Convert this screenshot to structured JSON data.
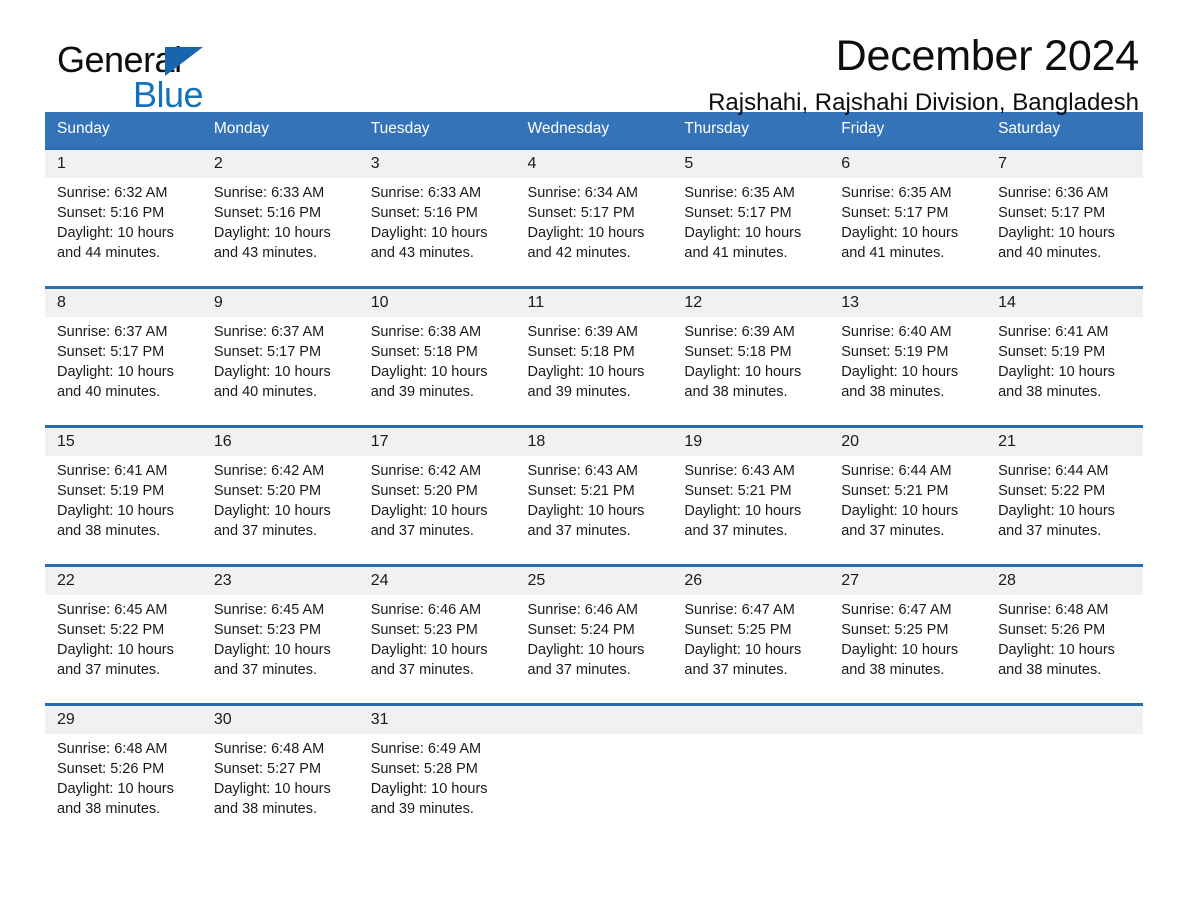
{
  "brand": {
    "name_part1": "General",
    "name_part2": "Blue",
    "triangle_color": "#1665ad",
    "blue_color": "#1272bd"
  },
  "header": {
    "title": "December 2024",
    "subtitle": "Rajshahi, Rajshahi Division, Bangladesh"
  },
  "theme": {
    "header_bar_color": "#3573b9",
    "row_top_border_color": "#2a6cb0",
    "daynum_band_color": "#f1f1f1"
  },
  "calendar": {
    "weekday_headers": [
      "Sunday",
      "Monday",
      "Tuesday",
      "Wednesday",
      "Thursday",
      "Friday",
      "Saturday"
    ],
    "weeks": [
      {
        "daynums": [
          "1",
          "2",
          "3",
          "4",
          "5",
          "6",
          "7"
        ],
        "cells": [
          {
            "sunrise": "Sunrise: 6:32 AM",
            "sunset": "Sunset: 5:16 PM",
            "daylight_1": "Daylight: 10 hours",
            "daylight_2": "and 44 minutes."
          },
          {
            "sunrise": "Sunrise: 6:33 AM",
            "sunset": "Sunset: 5:16 PM",
            "daylight_1": "Daylight: 10 hours",
            "daylight_2": "and 43 minutes."
          },
          {
            "sunrise": "Sunrise: 6:33 AM",
            "sunset": "Sunset: 5:16 PM",
            "daylight_1": "Daylight: 10 hours",
            "daylight_2": "and 43 minutes."
          },
          {
            "sunrise": "Sunrise: 6:34 AM",
            "sunset": "Sunset: 5:17 PM",
            "daylight_1": "Daylight: 10 hours",
            "daylight_2": "and 42 minutes."
          },
          {
            "sunrise": "Sunrise: 6:35 AM",
            "sunset": "Sunset: 5:17 PM",
            "daylight_1": "Daylight: 10 hours",
            "daylight_2": "and 41 minutes."
          },
          {
            "sunrise": "Sunrise: 6:35 AM",
            "sunset": "Sunset: 5:17 PM",
            "daylight_1": "Daylight: 10 hours",
            "daylight_2": "and 41 minutes."
          },
          {
            "sunrise": "Sunrise: 6:36 AM",
            "sunset": "Sunset: 5:17 PM",
            "daylight_1": "Daylight: 10 hours",
            "daylight_2": "and 40 minutes."
          }
        ]
      },
      {
        "daynums": [
          "8",
          "9",
          "10",
          "11",
          "12",
          "13",
          "14"
        ],
        "cells": [
          {
            "sunrise": "Sunrise: 6:37 AM",
            "sunset": "Sunset: 5:17 PM",
            "daylight_1": "Daylight: 10 hours",
            "daylight_2": "and 40 minutes."
          },
          {
            "sunrise": "Sunrise: 6:37 AM",
            "sunset": "Sunset: 5:17 PM",
            "daylight_1": "Daylight: 10 hours",
            "daylight_2": "and 40 minutes."
          },
          {
            "sunrise": "Sunrise: 6:38 AM",
            "sunset": "Sunset: 5:18 PM",
            "daylight_1": "Daylight: 10 hours",
            "daylight_2": "and 39 minutes."
          },
          {
            "sunrise": "Sunrise: 6:39 AM",
            "sunset": "Sunset: 5:18 PM",
            "daylight_1": "Daylight: 10 hours",
            "daylight_2": "and 39 minutes."
          },
          {
            "sunrise": "Sunrise: 6:39 AM",
            "sunset": "Sunset: 5:18 PM",
            "daylight_1": "Daylight: 10 hours",
            "daylight_2": "and 38 minutes."
          },
          {
            "sunrise": "Sunrise: 6:40 AM",
            "sunset": "Sunset: 5:19 PM",
            "daylight_1": "Daylight: 10 hours",
            "daylight_2": "and 38 minutes."
          },
          {
            "sunrise": "Sunrise: 6:41 AM",
            "sunset": "Sunset: 5:19 PM",
            "daylight_1": "Daylight: 10 hours",
            "daylight_2": "and 38 minutes."
          }
        ]
      },
      {
        "daynums": [
          "15",
          "16",
          "17",
          "18",
          "19",
          "20",
          "21"
        ],
        "cells": [
          {
            "sunrise": "Sunrise: 6:41 AM",
            "sunset": "Sunset: 5:19 PM",
            "daylight_1": "Daylight: 10 hours",
            "daylight_2": "and 38 minutes."
          },
          {
            "sunrise": "Sunrise: 6:42 AM",
            "sunset": "Sunset: 5:20 PM",
            "daylight_1": "Daylight: 10 hours",
            "daylight_2": "and 37 minutes."
          },
          {
            "sunrise": "Sunrise: 6:42 AM",
            "sunset": "Sunset: 5:20 PM",
            "daylight_1": "Daylight: 10 hours",
            "daylight_2": "and 37 minutes."
          },
          {
            "sunrise": "Sunrise: 6:43 AM",
            "sunset": "Sunset: 5:21 PM",
            "daylight_1": "Daylight: 10 hours",
            "daylight_2": "and 37 minutes."
          },
          {
            "sunrise": "Sunrise: 6:43 AM",
            "sunset": "Sunset: 5:21 PM",
            "daylight_1": "Daylight: 10 hours",
            "daylight_2": "and 37 minutes."
          },
          {
            "sunrise": "Sunrise: 6:44 AM",
            "sunset": "Sunset: 5:21 PM",
            "daylight_1": "Daylight: 10 hours",
            "daylight_2": "and 37 minutes."
          },
          {
            "sunrise": "Sunrise: 6:44 AM",
            "sunset": "Sunset: 5:22 PM",
            "daylight_1": "Daylight: 10 hours",
            "daylight_2": "and 37 minutes."
          }
        ]
      },
      {
        "daynums": [
          "22",
          "23",
          "24",
          "25",
          "26",
          "27",
          "28"
        ],
        "cells": [
          {
            "sunrise": "Sunrise: 6:45 AM",
            "sunset": "Sunset: 5:22 PM",
            "daylight_1": "Daylight: 10 hours",
            "daylight_2": "and 37 minutes."
          },
          {
            "sunrise": "Sunrise: 6:45 AM",
            "sunset": "Sunset: 5:23 PM",
            "daylight_1": "Daylight: 10 hours",
            "daylight_2": "and 37 minutes."
          },
          {
            "sunrise": "Sunrise: 6:46 AM",
            "sunset": "Sunset: 5:23 PM",
            "daylight_1": "Daylight: 10 hours",
            "daylight_2": "and 37 minutes."
          },
          {
            "sunrise": "Sunrise: 6:46 AM",
            "sunset": "Sunset: 5:24 PM",
            "daylight_1": "Daylight: 10 hours",
            "daylight_2": "and 37 minutes."
          },
          {
            "sunrise": "Sunrise: 6:47 AM",
            "sunset": "Sunset: 5:25 PM",
            "daylight_1": "Daylight: 10 hours",
            "daylight_2": "and 37 minutes."
          },
          {
            "sunrise": "Sunrise: 6:47 AM",
            "sunset": "Sunset: 5:25 PM",
            "daylight_1": "Daylight: 10 hours",
            "daylight_2": "and 38 minutes."
          },
          {
            "sunrise": "Sunrise: 6:48 AM",
            "sunset": "Sunset: 5:26 PM",
            "daylight_1": "Daylight: 10 hours",
            "daylight_2": "and 38 minutes."
          }
        ]
      },
      {
        "daynums": [
          "29",
          "30",
          "31",
          "",
          "",
          "",
          ""
        ],
        "cells": [
          {
            "sunrise": "Sunrise: 6:48 AM",
            "sunset": "Sunset: 5:26 PM",
            "daylight_1": "Daylight: 10 hours",
            "daylight_2": "and 38 minutes."
          },
          {
            "sunrise": "Sunrise: 6:48 AM",
            "sunset": "Sunset: 5:27 PM",
            "daylight_1": "Daylight: 10 hours",
            "daylight_2": "and 38 minutes."
          },
          {
            "sunrise": "Sunrise: 6:49 AM",
            "sunset": "Sunset: 5:28 PM",
            "daylight_1": "Daylight: 10 hours",
            "daylight_2": "and 39 minutes."
          },
          {
            "sunrise": "",
            "sunset": "",
            "daylight_1": "",
            "daylight_2": ""
          },
          {
            "sunrise": "",
            "sunset": "",
            "daylight_1": "",
            "daylight_2": ""
          },
          {
            "sunrise": "",
            "sunset": "",
            "daylight_1": "",
            "daylight_2": ""
          },
          {
            "sunrise": "",
            "sunset": "",
            "daylight_1": "",
            "daylight_2": ""
          }
        ]
      }
    ]
  }
}
